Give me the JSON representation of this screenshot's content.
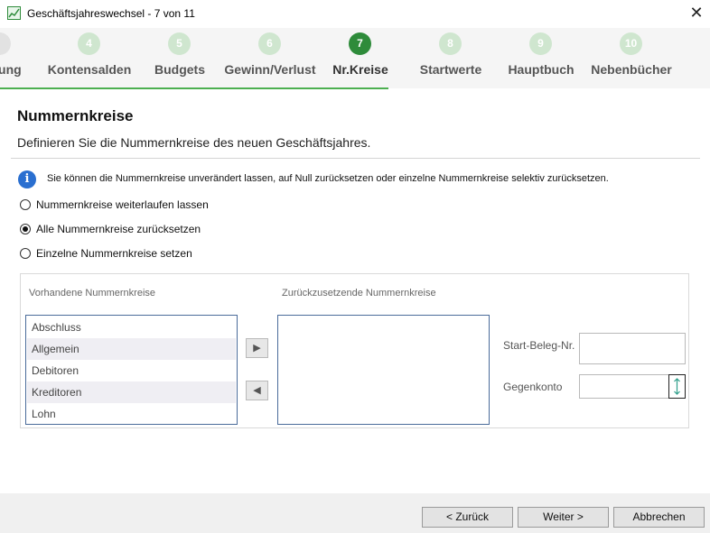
{
  "window": {
    "title": "Geschäftsjahreswechsel - 7 von 11",
    "close_label": "✕"
  },
  "steps": [
    {
      "number": "",
      "label": "herung"
    },
    {
      "number": "4",
      "label": "Kontensalden"
    },
    {
      "number": "5",
      "label": "Budgets"
    },
    {
      "number": "6",
      "label": "Gewinn/Verlust"
    },
    {
      "number": "7",
      "label": "Nr.Kreise"
    },
    {
      "number": "8",
      "label": "Startwerte"
    },
    {
      "number": "9",
      "label": "Hauptbuch"
    },
    {
      "number": "10",
      "label": "Nebenbücher"
    }
  ],
  "page": {
    "heading": "Nummernkreise",
    "subtitle": "Definieren Sie die Nummernkreise des neuen Geschäftsjahres."
  },
  "info": {
    "icon": "info-icon",
    "text": "Sie können die Nummernkreise unverändert lassen, auf Null zurücksetzen oder einzelne Nummernkreise selektiv zurücksetzen."
  },
  "options": [
    {
      "label": "Nummernkreise weiterlaufen lassen",
      "checked": false
    },
    {
      "label": "Alle Nummernkreise zurücksetzen",
      "checked": true
    },
    {
      "label": "Einzelne Nummernkreise setzen",
      "checked": false
    }
  ],
  "lists": {
    "available_label": "Vorhandene Nummernkreise",
    "reset_label": "Zurückzusetzende Nummernkreise",
    "available_items": [
      "Abschluss",
      "Allgemein",
      "Debitoren",
      "Kreditoren",
      "Lohn"
    ],
    "add_arrow": "▶",
    "remove_arrow": "◀"
  },
  "fields": {
    "start_label": "Start-Beleg-Nr.",
    "start_value": "",
    "gegenkonto_label": "Gegenkonto",
    "gegenkonto_value": ""
  },
  "buttons": {
    "back": "< Zurück",
    "next": "Weiter >",
    "cancel": "Abbrechen"
  },
  "colors": {
    "accent": "#2e8b3a",
    "accent_light": "#cfe6cf",
    "progress_line": "#4caf50",
    "info_blue": "#2a6fd0"
  }
}
